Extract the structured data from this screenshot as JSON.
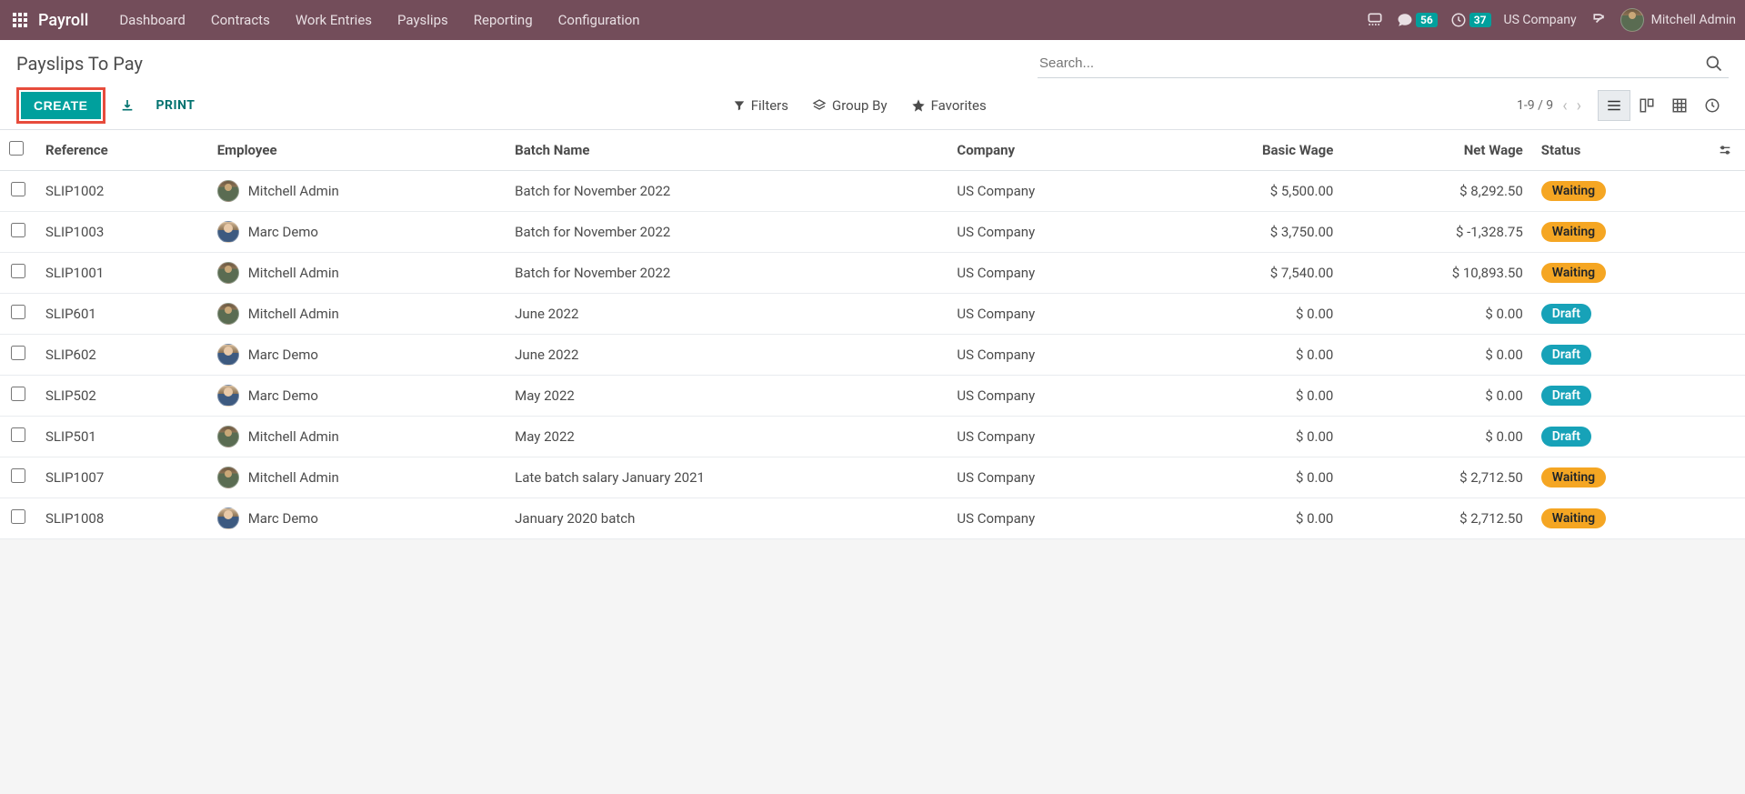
{
  "topbar": {
    "app_name": "Payroll",
    "nav": [
      "Dashboard",
      "Contracts",
      "Work Entries",
      "Payslips",
      "Reporting",
      "Configuration"
    ],
    "messages_count": "56",
    "activities_count": "37",
    "company": "US Company",
    "user_name": "Mitchell Admin"
  },
  "control": {
    "breadcrumb": "Payslips To Pay",
    "search_placeholder": "Search...",
    "create_label": "CREATE",
    "print_label": "PRINT",
    "filters_label": "Filters",
    "groupby_label": "Group By",
    "favorites_label": "Favorites",
    "pager": "1-9 / 9"
  },
  "table": {
    "headers": {
      "reference": "Reference",
      "employee": "Employee",
      "batch": "Batch Name",
      "company": "Company",
      "basic": "Basic Wage",
      "net": "Net Wage",
      "status": "Status"
    },
    "rows": [
      {
        "ref": "SLIP1002",
        "emp": "Mitchell Admin",
        "avatar": "mitchell",
        "batch": "Batch for November 2022",
        "company": "US Company",
        "basic": "$ 5,500.00",
        "net": "$ 8,292.50",
        "status": "Waiting",
        "status_class": "waiting"
      },
      {
        "ref": "SLIP1003",
        "emp": "Marc Demo",
        "avatar": "marc",
        "batch": "Batch for November 2022",
        "company": "US Company",
        "basic": "$ 3,750.00",
        "net": "$ -1,328.75",
        "status": "Waiting",
        "status_class": "waiting"
      },
      {
        "ref": "SLIP1001",
        "emp": "Mitchell Admin",
        "avatar": "mitchell",
        "batch": "Batch for November 2022",
        "company": "US Company",
        "basic": "$ 7,540.00",
        "net": "$ 10,893.50",
        "status": "Waiting",
        "status_class": "waiting"
      },
      {
        "ref": "SLIP601",
        "emp": "Mitchell Admin",
        "avatar": "mitchell",
        "batch": "June 2022",
        "company": "US Company",
        "basic": "$ 0.00",
        "net": "$ 0.00",
        "status": "Draft",
        "status_class": "draft"
      },
      {
        "ref": "SLIP602",
        "emp": "Marc Demo",
        "avatar": "marc",
        "batch": "June 2022",
        "company": "US Company",
        "basic": "$ 0.00",
        "net": "$ 0.00",
        "status": "Draft",
        "status_class": "draft"
      },
      {
        "ref": "SLIP502",
        "emp": "Marc Demo",
        "avatar": "marc",
        "batch": "May 2022",
        "company": "US Company",
        "basic": "$ 0.00",
        "net": "$ 0.00",
        "status": "Draft",
        "status_class": "draft"
      },
      {
        "ref": "SLIP501",
        "emp": "Mitchell Admin",
        "avatar": "mitchell",
        "batch": "May 2022",
        "company": "US Company",
        "basic": "$ 0.00",
        "net": "$ 0.00",
        "status": "Draft",
        "status_class": "draft"
      },
      {
        "ref": "SLIP1007",
        "emp": "Mitchell Admin",
        "avatar": "mitchell",
        "batch": "Late batch salary January 2021",
        "company": "US Company",
        "basic": "$ 0.00",
        "net": "$ 2,712.50",
        "status": "Waiting",
        "status_class": "waiting"
      },
      {
        "ref": "SLIP1008",
        "emp": "Marc Demo",
        "avatar": "marc",
        "batch": "January 2020 batch",
        "company": "US Company",
        "basic": "$ 0.00",
        "net": "$ 2,712.50",
        "status": "Waiting",
        "status_class": "waiting"
      }
    ]
  }
}
